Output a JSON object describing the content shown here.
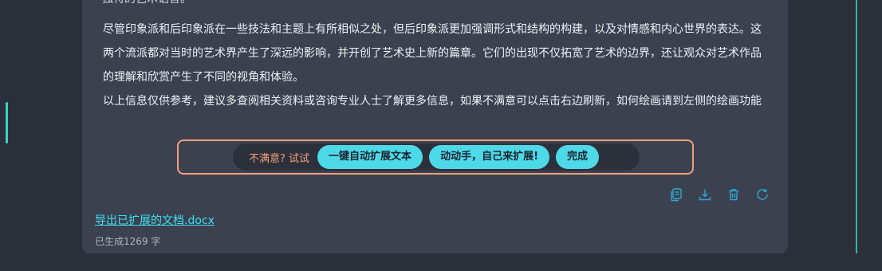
{
  "content": {
    "cut_line": "独特的艺术语言。",
    "paragraph1": "尽管印象派和后印象派在一些技法和主题上有所相似之处，但后印象派更加强调形式和结构的构建，以及对情感和内心世界的表达。这两个流派都对当时的艺术界产生了深远的影响，并开创了艺术史上新的篇章。它们的出现不仅拓宽了艺术的边界，还让观众对艺术作品的理解和欣赏产生了不同的视角和体验。",
    "paragraph2": "以上信息仅供参考，建议多查阅相关资料或咨询专业人士了解更多信息，如果不满意可以点击右边刷新，如何绘画请到左侧的绘画功能"
  },
  "suggestion": {
    "label": "不满意? 试试",
    "buttons": {
      "auto_expand": "一键自动扩展文本",
      "manual_expand": "动动手，自己来扩展!",
      "done": "完成"
    }
  },
  "toolbar": {
    "icons": [
      "copy-icon",
      "download-icon",
      "trash-icon",
      "refresh-icon"
    ]
  },
  "footer": {
    "export_link": "导出已扩展的文档.docx",
    "generated_count": "已生成1269 字"
  },
  "colors": {
    "accent_cyan": "#4dd9e8",
    "accent_orange": "#f0a07a",
    "card_bg": "#3c4150",
    "page_bg": "#2b2f3a"
  }
}
